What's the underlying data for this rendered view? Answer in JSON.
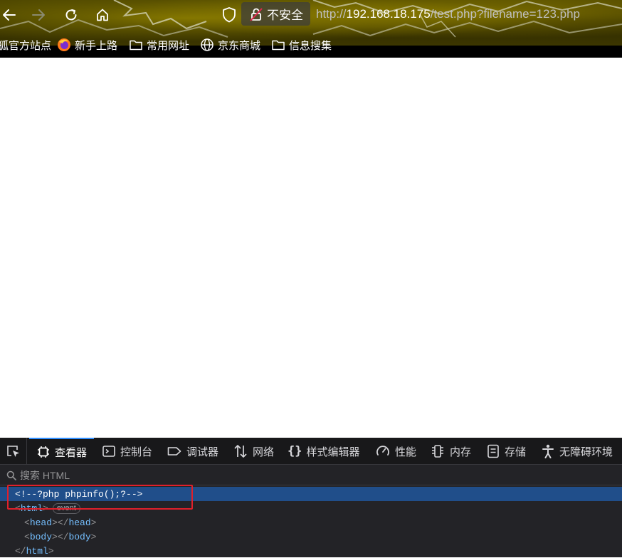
{
  "browser": {
    "security_label": "不安全",
    "url_prefix": "http://",
    "url_host": "192.168.18.175",
    "url_path": "/test.php?filename=123.php"
  },
  "bookmarks": [
    {
      "label": "狐官方站点",
      "icon": "bookmark-icon"
    },
    {
      "label": "新手上路",
      "icon": "firefox-icon"
    },
    {
      "label": "常用网址",
      "icon": "folder-icon"
    },
    {
      "label": "京东商城",
      "icon": "globe-icon"
    },
    {
      "label": "信息搜集",
      "icon": "folder-icon"
    }
  ],
  "devtools": {
    "tabs": [
      {
        "label": "查看器",
        "icon": "inspector-icon",
        "active": true
      },
      {
        "label": "控制台",
        "icon": "console-icon"
      },
      {
        "label": "调试器",
        "icon": "debugger-icon"
      },
      {
        "label": "网络",
        "icon": "network-icon"
      },
      {
        "label": "样式编辑器",
        "icon": "style-editor-icon"
      },
      {
        "label": "性能",
        "icon": "performance-icon"
      },
      {
        "label": "内存",
        "icon": "memory-icon"
      },
      {
        "label": "存储",
        "icon": "storage-icon"
      },
      {
        "label": "无障碍环境",
        "icon": "accessibility-icon"
      }
    ],
    "search_placeholder": "搜索 HTML",
    "tree": {
      "comment": "<!--?php phpinfo();?-->",
      "html_open": "html",
      "event_badge": "event",
      "head": "head",
      "body": "body",
      "html_close": "html"
    }
  },
  "colors": {
    "accent": "#2f8eff",
    "selection": "#204e8a",
    "highlight_box": "#e0202a",
    "tag": "#75bfff"
  }
}
